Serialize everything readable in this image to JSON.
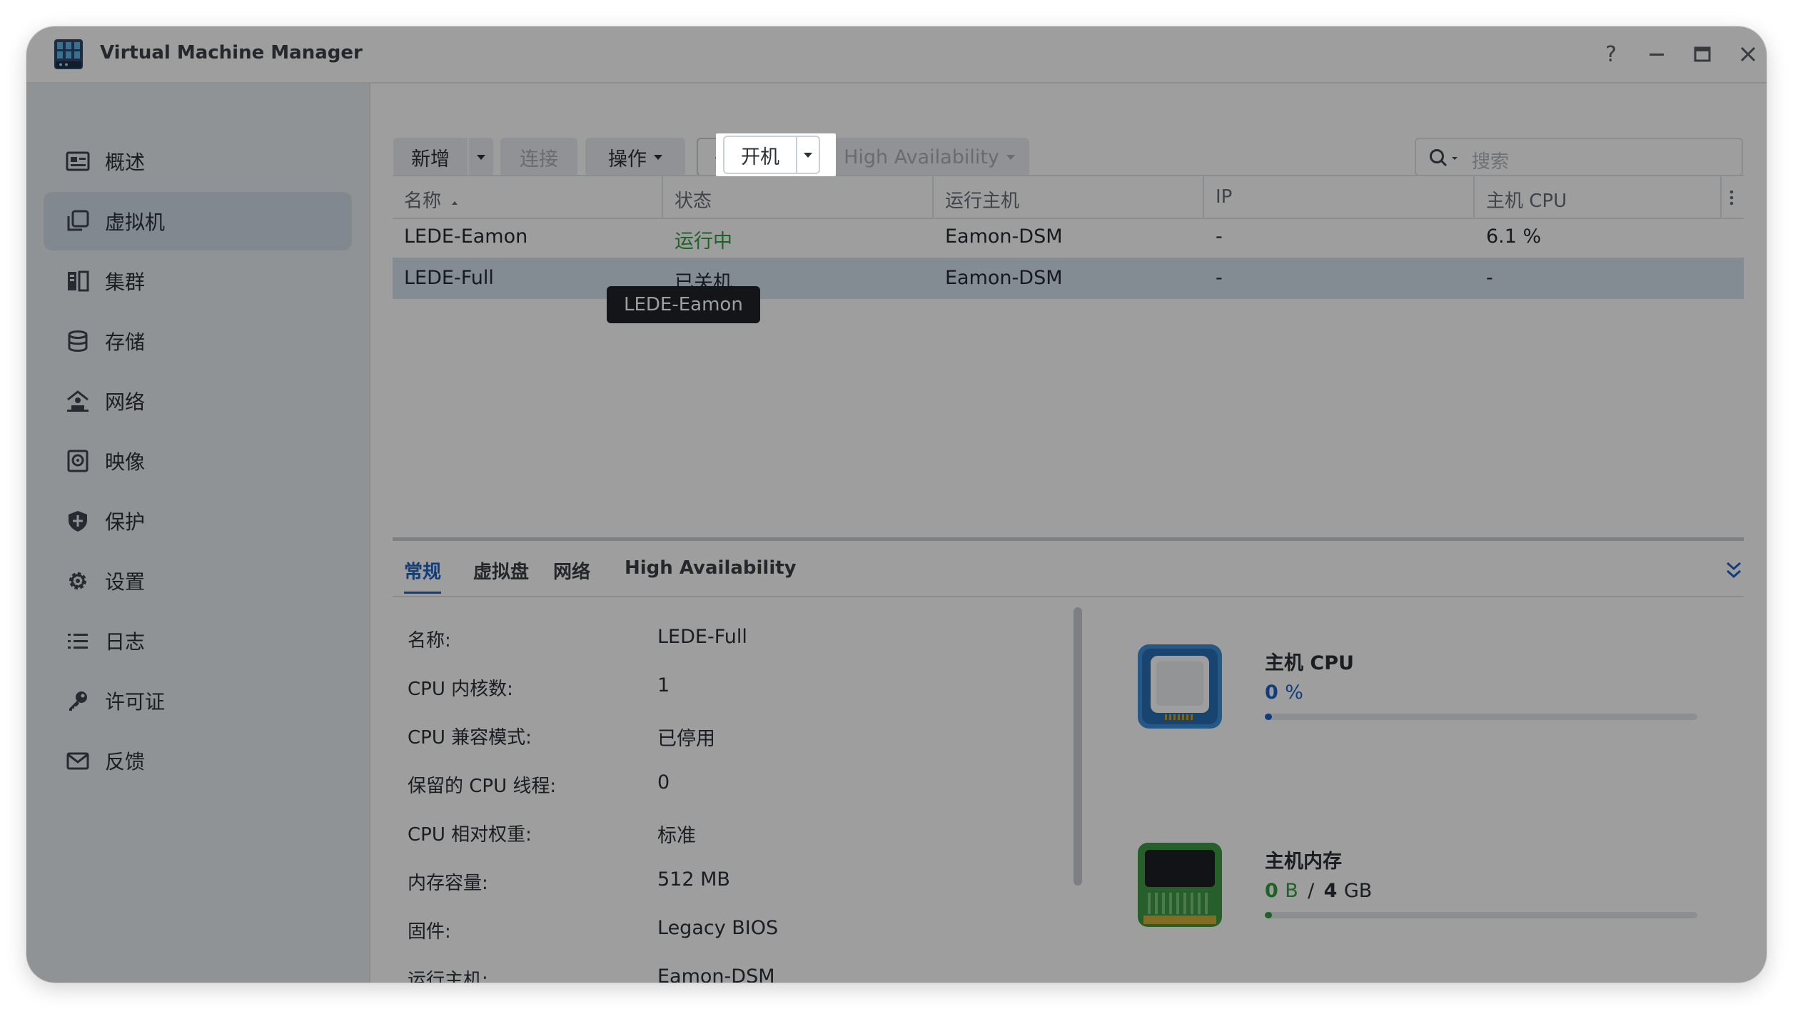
{
  "window": {
    "title": "Virtual Machine Manager",
    "controls": {
      "help": "?",
      "minimize": "—",
      "maximize": "▭",
      "close": "✕"
    }
  },
  "sidebar": {
    "items": [
      {
        "label": "概述",
        "icon": "overview-icon"
      },
      {
        "label": "虚拟机",
        "icon": "virtual-machine-icon",
        "active": true
      },
      {
        "label": "集群",
        "icon": "cluster-icon"
      },
      {
        "label": "存储",
        "icon": "storage-icon"
      },
      {
        "label": "网络",
        "icon": "network-icon"
      },
      {
        "label": "映像",
        "icon": "image-icon"
      },
      {
        "label": "保护",
        "icon": "shield-icon"
      },
      {
        "label": "设置",
        "icon": "gear-icon"
      },
      {
        "label": "日志",
        "icon": "list-icon"
      },
      {
        "label": "许可证",
        "icon": "key-icon"
      },
      {
        "label": "反馈",
        "icon": "mail-icon"
      }
    ]
  },
  "toolbar": {
    "create": "新增",
    "connect": "连接",
    "action": "操作",
    "power_on": "开机",
    "high_availability": "High Availability",
    "search_placeholder": "搜索"
  },
  "table": {
    "columns": [
      "名称",
      "状态",
      "运行主机",
      "IP",
      "主机 CPU"
    ],
    "rows": [
      {
        "name": "LEDE-Eamon",
        "status": "运行中",
        "host": "Eamon-DSM",
        "ip": "-",
        "cpu": "6.1 %"
      },
      {
        "name": "LEDE-Full",
        "status": "已关机",
        "host": "Eamon-DSM",
        "ip": "-",
        "cpu": "-"
      }
    ],
    "tooltip": "LEDE-Eamon"
  },
  "detail_tabs": [
    "常规",
    "虚拟盘",
    "网络",
    "High Availability"
  ],
  "details": [
    {
      "label": "名称:",
      "value": "LEDE-Full"
    },
    {
      "label": "CPU 内核数:",
      "value": "1"
    },
    {
      "label": "CPU 兼容模式:",
      "value": "已停用"
    },
    {
      "label": "保留的 CPU 线程:",
      "value": "0"
    },
    {
      "label": "CPU 相对权重:",
      "value": "标准"
    },
    {
      "label": "内存容量:",
      "value": "512 MB"
    },
    {
      "label": "固件:",
      "value": "Legacy BIOS"
    },
    {
      "label": "运行主机:",
      "value": "Eamon-DSM"
    }
  ],
  "resources": {
    "cpu": {
      "title": "主机 CPU",
      "value": "0",
      "unit": "%",
      "percent": 0
    },
    "memory": {
      "title": "主机内存",
      "used": "0",
      "used_unit": "B",
      "sep": "/",
      "total": "4",
      "total_unit": "GB",
      "percent": 0
    }
  },
  "colors": {
    "accent": "#1e63c7",
    "running": "#2f9e3e",
    "selected_row": "#d3e0ee",
    "memory_fill": "#2f9e3e",
    "cpu_fill": "#1e63c7"
  }
}
